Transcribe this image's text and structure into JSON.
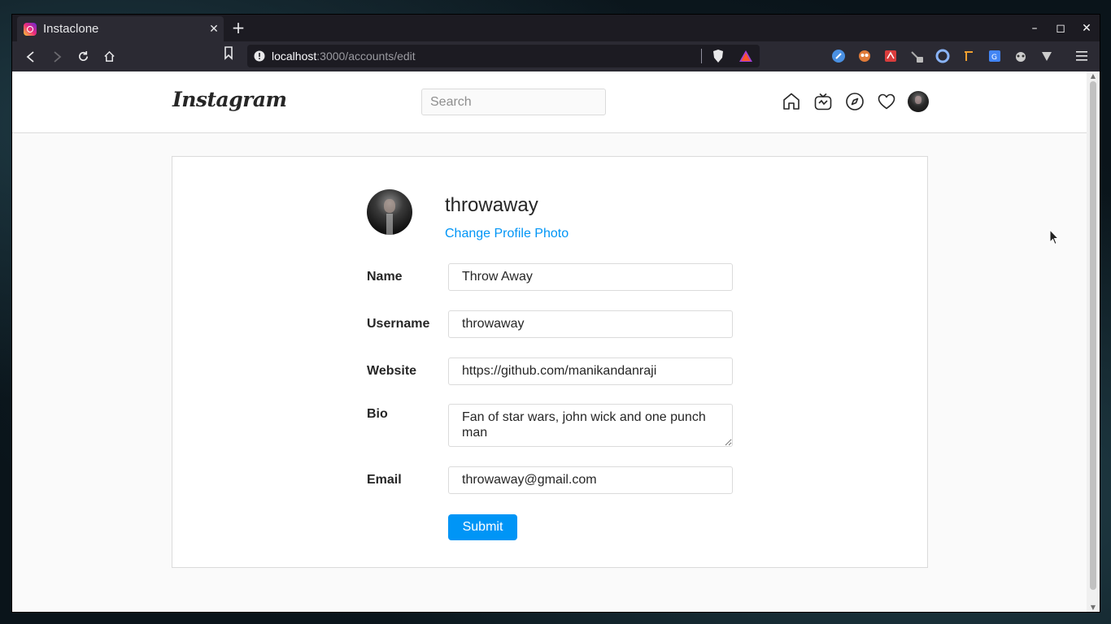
{
  "browser": {
    "tab_title": "Instaclone",
    "url_host": "localhost",
    "url_rest": ":3000/accounts/edit"
  },
  "header": {
    "logo_text": "Instagram",
    "search_placeholder": "Search"
  },
  "profile": {
    "username": "throwaway",
    "change_photo_label": "Change Profile Photo"
  },
  "form": {
    "name_label": "Name",
    "name_value": "Throw Away",
    "username_label": "Username",
    "username_value": "throwaway",
    "website_label": "Website",
    "website_value": "https://github.com/manikandanraji",
    "bio_label": "Bio",
    "bio_value": "Fan of star wars, john wick and one punch man",
    "email_label": "Email",
    "email_value": "throwaway@gmail.com",
    "submit_label": "Submit"
  },
  "colors": {
    "accent": "#0095f6",
    "border": "#dbdbdb",
    "text": "#262626"
  }
}
